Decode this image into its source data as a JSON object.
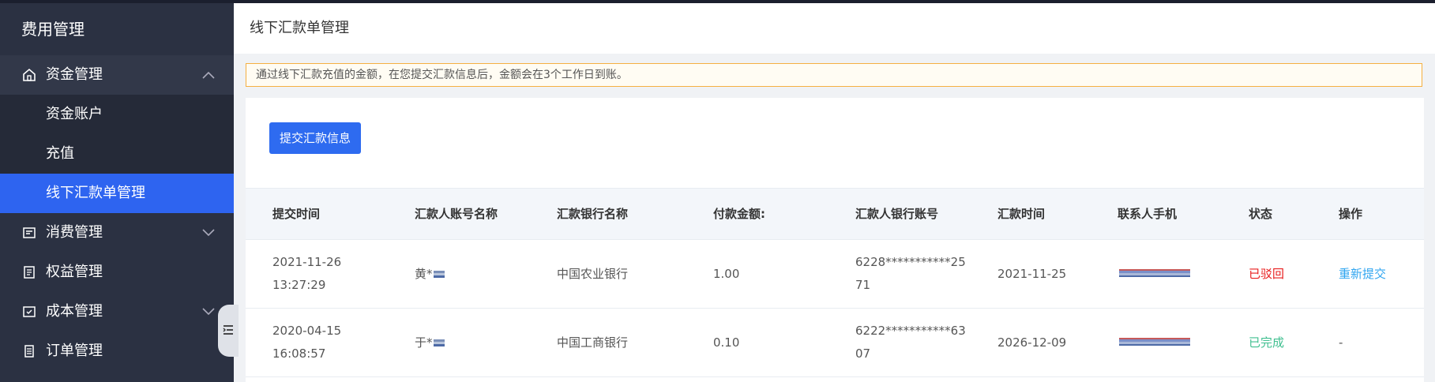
{
  "sidebar": {
    "title": "费用管理",
    "menu": [
      {
        "label": "资金管理",
        "icon": "home-icon",
        "expanded": true,
        "children": [
          {
            "label": "资金账户"
          },
          {
            "label": "充值"
          },
          {
            "label": "线下汇款单管理",
            "active": true
          }
        ]
      },
      {
        "label": "消费管理",
        "icon": "expense-icon"
      },
      {
        "label": "权益管理",
        "icon": "rights-icon"
      },
      {
        "label": "成本管理",
        "icon": "cost-icon"
      },
      {
        "label": "订单管理",
        "icon": "order-icon"
      }
    ]
  },
  "header": {
    "title": "线下汇款单管理"
  },
  "notice": {
    "text": "通过线下汇款充值的金额，在您提交汇款信息后，金额会在3个工作日到账。"
  },
  "toolbar": {
    "submit_label": "提交汇款信息"
  },
  "table": {
    "columns": [
      "提交时间",
      "汇款人账号名称",
      "汇款银行名称",
      "付款金额:",
      "汇款人银行账号",
      "汇款时间",
      "联系人手机",
      "状态",
      "操作"
    ],
    "rows": [
      {
        "submit_date": "2021-11-26",
        "submit_time": "13:27:29",
        "account_name": "黄*",
        "bank": "中国农业银行",
        "amount": "1.00",
        "account_no_1": "6228***********25",
        "account_no_2": "71",
        "remit_date": "2021-11-25",
        "status": "已驳回",
        "action": "重新提交"
      },
      {
        "submit_date": "2020-04-15",
        "submit_time": "16:08:57",
        "account_name": "于*",
        "bank": "中国工商银行",
        "amount": "0.10",
        "account_no_1": "6222***********63",
        "account_no_2": "07",
        "remit_date": "2026-12-09",
        "status": "已完成",
        "action": "-"
      }
    ]
  },
  "colors": {
    "sidebar_bg": "#2b3142",
    "active_blue": "#2e64f0",
    "rejected": "#e81c1c",
    "completed": "#3fbf8f",
    "link": "#31a6f0"
  }
}
